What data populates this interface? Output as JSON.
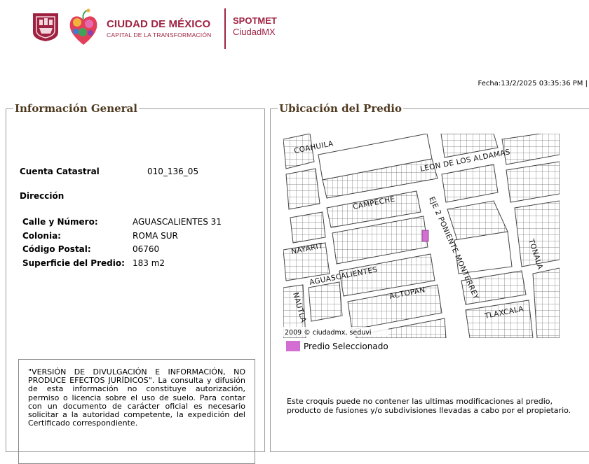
{
  "header": {
    "brand_title": "CIUDAD DE MÉXICO",
    "brand_subtitle": "CAPITAL DE LA TRANSFORMACIÓN",
    "app_title": "SPOTMET",
    "app_subtitle": "CiudadMX",
    "seal_icon": "cdmx-seal-icon",
    "heart_icon": "floral-heart-icon",
    "brand_color": "#9f2241"
  },
  "fecha": "Fecha:13/2/2025 03:35:36 PM |",
  "info": {
    "legend": "Información General",
    "cuenta_label": "Cuenta Catastral",
    "cuenta_value": "010_136_05",
    "direccion_title": "Dirección",
    "address": [
      {
        "label": "Calle y Número:",
        "value": "AGUASCALIENTES 31"
      },
      {
        "label": "Colonia:",
        "value": "ROMA SUR"
      },
      {
        "label": "Código Postal:",
        "value": "06760"
      },
      {
        "label": "Superficie del Predio:",
        "value": "183 m2"
      }
    ],
    "disclaimer": "\"VERSIÓN DE DIVULGACIÓN E INFORMACIÓN, NO PRODUCE EFECTOS JURÍDICOS\". La consulta y difusión de esta información no constituye autorización, permiso o licencia sobre el uso de suelo. Para contar con un documento de carácter oficial es necesario solicitar a la autoridad competente, la expedición del Certificado correspondiente."
  },
  "ubicacion": {
    "legend": "Ubicación del Predio",
    "streets": {
      "coahuila": "COAHUILA",
      "leon": "LEON DE LOS ALDAMAS",
      "campeche": "CAMPECHE",
      "eje2": "EJE 2 PONIENTE MONTERREY",
      "nayarit": "NAYARIT",
      "tonala": "TONALA",
      "aguascalientes": "AGUASCALIENTES",
      "actopan": "ACTOPAN",
      "tlaxcala": "TLAXCALA",
      "nautla": "NAUTLA"
    },
    "copyright": "2009 © ciudadmx, seduvi",
    "legend_item": "Predio Seleccionado",
    "selected_color": "#d36fd3",
    "note": "Este croquis puede no contener las ultimas modificaciones al predio, producto de fusiones y/o subdivisiones llevadas a cabo por el propietario."
  }
}
